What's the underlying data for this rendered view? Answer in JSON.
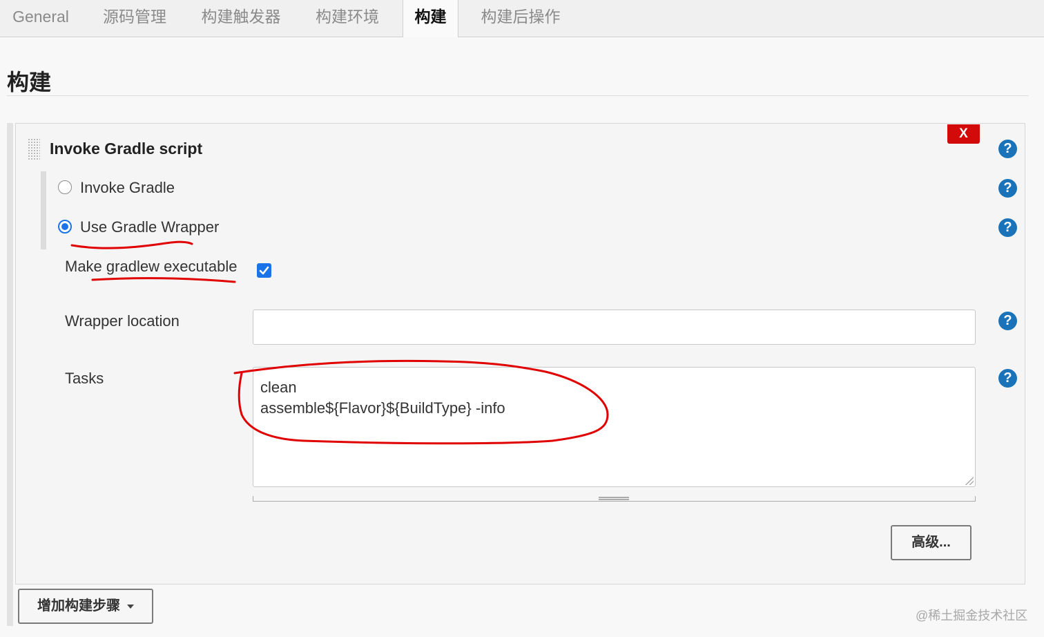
{
  "tabs": [
    {
      "label": "General",
      "active": false
    },
    {
      "label": "源码管理",
      "active": false
    },
    {
      "label": "构建触发器",
      "active": false
    },
    {
      "label": "构建环境",
      "active": false
    },
    {
      "label": "构建",
      "active": true
    },
    {
      "label": "构建后操作",
      "active": false
    }
  ],
  "section": {
    "title": "构建"
  },
  "step": {
    "title": "Invoke Gradle script",
    "delete_label": "X",
    "help_symbol": "?",
    "options": [
      {
        "label": "Invoke Gradle",
        "selected": false
      },
      {
        "label": "Use Gradle Wrapper",
        "selected": true
      }
    ],
    "make_executable": {
      "label": "Make gradlew executable",
      "checked": true
    },
    "wrapper_location": {
      "label": "Wrapper location",
      "value": ""
    },
    "tasks": {
      "label": "Tasks",
      "lines": [
        "clean",
        "assemble${Flavor}${BuildType} -info"
      ]
    },
    "advanced_label": "高级..."
  },
  "add_step_label": "增加构建步骤",
  "watermark": "@稀土掘金技术社区",
  "colors": {
    "accent": "#1a73e8",
    "help": "#1a73b8",
    "delete": "#d20a0a",
    "annotation": "#e00000"
  }
}
